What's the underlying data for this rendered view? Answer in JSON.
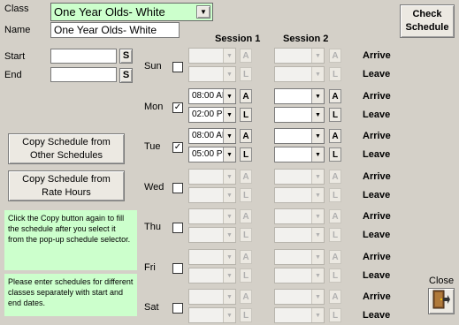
{
  "header": {
    "class_label": "Class",
    "class_value": "One Year Olds- White",
    "name_label": "Name",
    "name_value": "One Year Olds- White",
    "start_label": "Start",
    "end_label": "End",
    "start_value": "",
    "end_value": "",
    "s_button": "S",
    "session1_label": "Session 1",
    "session2_label": "Session 2",
    "check_schedule_label": "Check Schedule"
  },
  "buttons": {
    "copy_other": "Copy Schedule from Other Schedules",
    "copy_rate": "Copy Schedule from Rate Hours",
    "close_label": "Close"
  },
  "notes": {
    "note1": "Click the Copy button again to fill the schedule after you select it from the pop-up schedule selector.",
    "note2": "Please enter schedules for different classes separately with start and end dates."
  },
  "row_labels": {
    "arrive": "Arrive",
    "leave": "Leave",
    "a": "A",
    "l": "L"
  },
  "days": [
    {
      "name": "Sun",
      "checked": false,
      "s1_arrive": "",
      "s1_leave": "",
      "s2_arrive": "",
      "s2_leave": ""
    },
    {
      "name": "Mon",
      "checked": true,
      "s1_arrive": "08:00 AM",
      "s1_leave": "02:00 PM",
      "s2_arrive": "",
      "s2_leave": ""
    },
    {
      "name": "Tue",
      "checked": true,
      "s1_arrive": "08:00 AM",
      "s1_leave": "05:00 PM",
      "s2_arrive": "",
      "s2_leave": ""
    },
    {
      "name": "Wed",
      "checked": false,
      "s1_arrive": "",
      "s1_leave": "",
      "s2_arrive": "",
      "s2_leave": ""
    },
    {
      "name": "Thu",
      "checked": false,
      "s1_arrive": "",
      "s1_leave": "",
      "s2_arrive": "",
      "s2_leave": ""
    },
    {
      "name": "Fri",
      "checked": false,
      "s1_arrive": "",
      "s1_leave": "",
      "s2_arrive": "",
      "s2_leave": ""
    },
    {
      "name": "Sat",
      "checked": false,
      "s1_arrive": "",
      "s1_leave": "",
      "s2_arrive": "",
      "s2_leave": ""
    }
  ],
  "colors": {
    "background": "#d4d0c8",
    "highlight": "#ccffcc"
  },
  "icons": {
    "dropdown": "chevron-down-icon",
    "close": "door-exit-icon"
  }
}
